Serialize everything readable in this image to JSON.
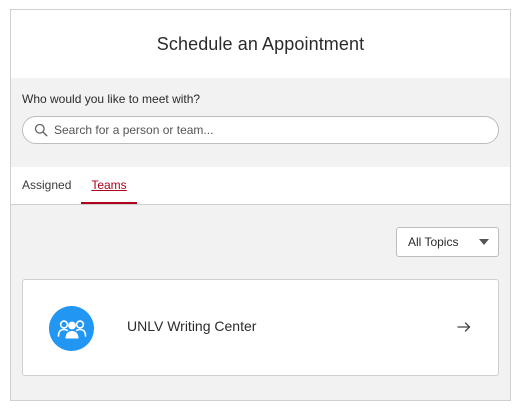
{
  "dialog": {
    "title": "Schedule an Appointment"
  },
  "who": {
    "label": "Who would you like to meet with?",
    "search_placeholder": "Search for a person or team...",
    "search_value": ""
  },
  "tabs": [
    {
      "label": "Assigned",
      "active": false
    },
    {
      "label": "Teams",
      "active": true
    }
  ],
  "filter": {
    "selected": "All Topics"
  },
  "teams": [
    {
      "name": "UNLV Writing Center",
      "icon": "team-icon"
    }
  ],
  "colors": {
    "accent": "#b1001c",
    "avatar": "#2196f3",
    "panel_bg": "#f2f2f2"
  }
}
